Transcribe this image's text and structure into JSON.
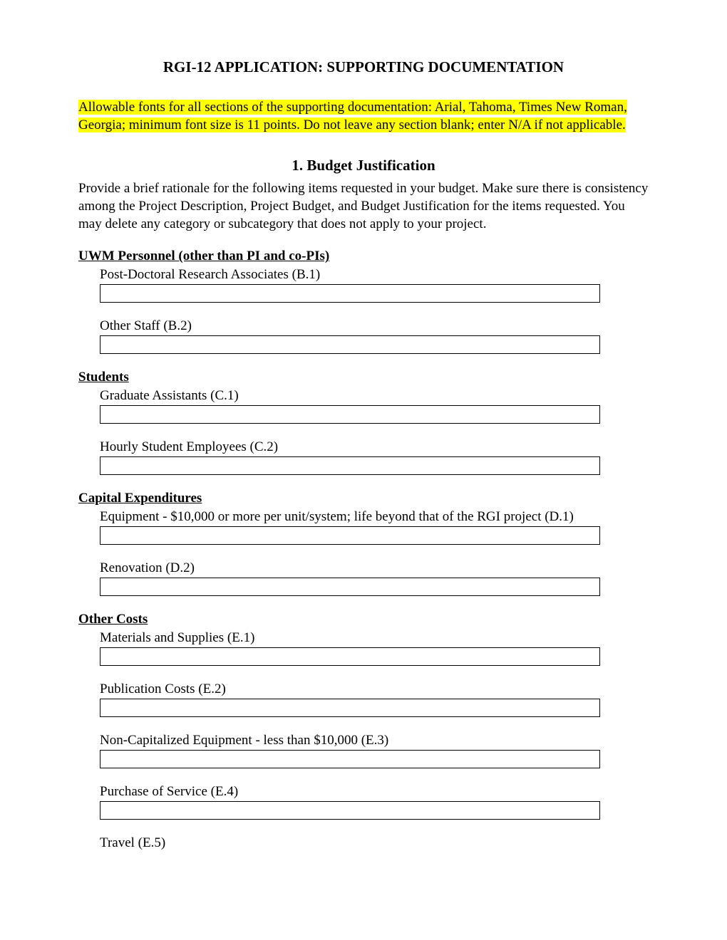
{
  "title": "RGI-12 APPLICATION: SUPPORTING DOCUMENTATION",
  "highlight": "Allowable fonts for all sections of the supporting documentation: Arial, Tahoma, Times New Roman, Georgia; minimum font size is 11 points.  Do not leave any section blank; enter N/A if not applicable.",
  "subtitle": "1. Budget Justification",
  "intro": "Provide a brief rationale for the following items requested in your budget. Make sure there is consistency among the Project Description, Project Budget, and Budget Justification for the items requested.  You may delete any category or subcategory that does not apply to your project.",
  "sections": {
    "personnel": {
      "header": "UWM Personnel (other than PI and co-PIs)",
      "b1": "Post-Doctoral Research Associates (B.1)",
      "b2": "Other Staff (B.2)"
    },
    "students": {
      "header": "Students",
      "c1": "Graduate Assistants (C.1)",
      "c2": "Hourly Student Employees (C.2)"
    },
    "capital": {
      "header": "Capital Expenditures",
      "d1": "Equipment - $10,000 or more per unit/system; life beyond that of the RGI project (D.1)",
      "d2": "Renovation (D.2)"
    },
    "other": {
      "header": "Other Costs",
      "e1": "Materials and Supplies (E.1)",
      "e2": "Publication Costs (E.2)",
      "e3": "Non-Capitalized Equipment - less than $10,000 (E.3)",
      "e4": "Purchase of Service (E.4)",
      "e5": "Travel (E.5)"
    }
  }
}
